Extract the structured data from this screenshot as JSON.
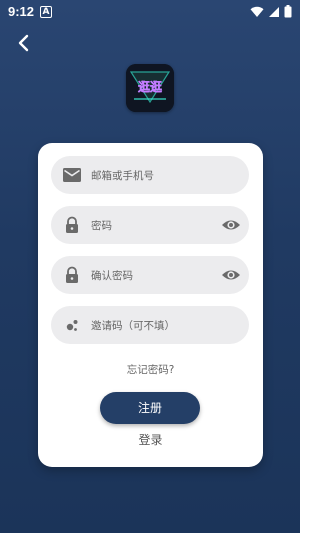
{
  "status_bar": {
    "time": "9:12",
    "indicator": "A",
    "icons": [
      "wifi-icon",
      "signal-icon",
      "battery-icon"
    ]
  },
  "header": {
    "back_icon": "chevron-left-icon",
    "logo_label": "logo"
  },
  "form": {
    "email": {
      "placeholder": "邮箱或手机号",
      "icon": "mail-icon"
    },
    "password": {
      "placeholder": "密码",
      "icon": "lock-icon"
    },
    "confirm_password": {
      "placeholder": "确认密码",
      "icon": "lock-icon"
    },
    "invite_code": {
      "placeholder": "邀请码（可不填）",
      "icon": "dots-icon"
    }
  },
  "links": {
    "forgot": "忘记密码?",
    "login": "登录"
  },
  "buttons": {
    "register": "注册"
  },
  "colors": {
    "background": "#203a62",
    "card": "#ffffff",
    "field": "#ececee",
    "primary": "#243f67"
  }
}
